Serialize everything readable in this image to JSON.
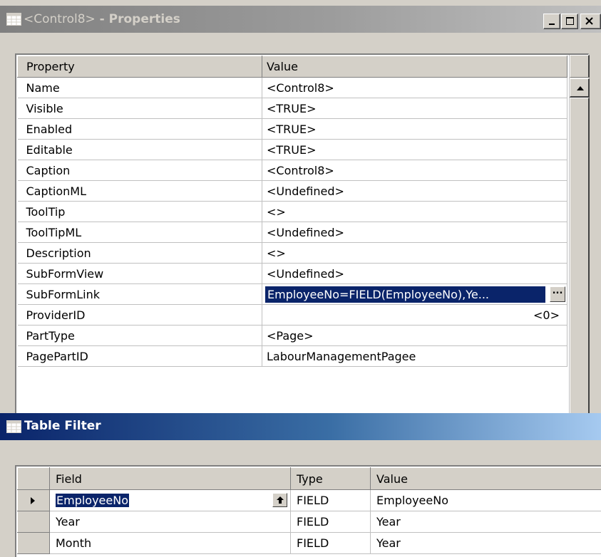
{
  "properties_window": {
    "title_bold_left": "<Control8>",
    "title_rest": " - Properties",
    "columns": {
      "property": "Property",
      "value": "Value"
    },
    "rows": [
      {
        "property": "Name",
        "value": "<Control8>"
      },
      {
        "property": "Visible",
        "value": "<TRUE>"
      },
      {
        "property": "Enabled",
        "value": "<TRUE>"
      },
      {
        "property": "Editable",
        "value": "<TRUE>"
      },
      {
        "property": "Caption",
        "value": "<Control8>"
      },
      {
        "property": "CaptionML",
        "value": "<Undefined>"
      },
      {
        "property": "ToolTip",
        "value": "<>"
      },
      {
        "property": "ToolTipML",
        "value": "<Undefined>"
      },
      {
        "property": "Description",
        "value": "<>"
      },
      {
        "property": "SubFormView",
        "value": "<Undefined>"
      },
      {
        "property": "SubFormLink",
        "value": "EmployeeNo=FIELD(EmployeeNo),Ye..."
      },
      {
        "property": "ProviderID",
        "value": "<0>"
      },
      {
        "property": "PartType",
        "value": "<Page>"
      },
      {
        "property": "PagePartID",
        "value": "LabourManagementPagee"
      }
    ],
    "ellipsis_label": "..."
  },
  "filter_window": {
    "title": "Table Filter",
    "columns": {
      "field": "Field",
      "type": "Type",
      "value": "Value"
    },
    "rows": [
      {
        "field": "EmployeeNo",
        "type": "FIELD",
        "value": "EmployeeNo"
      },
      {
        "field": "Year",
        "type": "FIELD",
        "value": "Year"
      },
      {
        "field": "Month",
        "type": "FIELD",
        "value": "Year"
      }
    ]
  },
  "colors": {
    "inactive_title": "#808080",
    "active_title": "#0a246a",
    "selection": "#0a246a",
    "face": "#d4d0c8"
  }
}
